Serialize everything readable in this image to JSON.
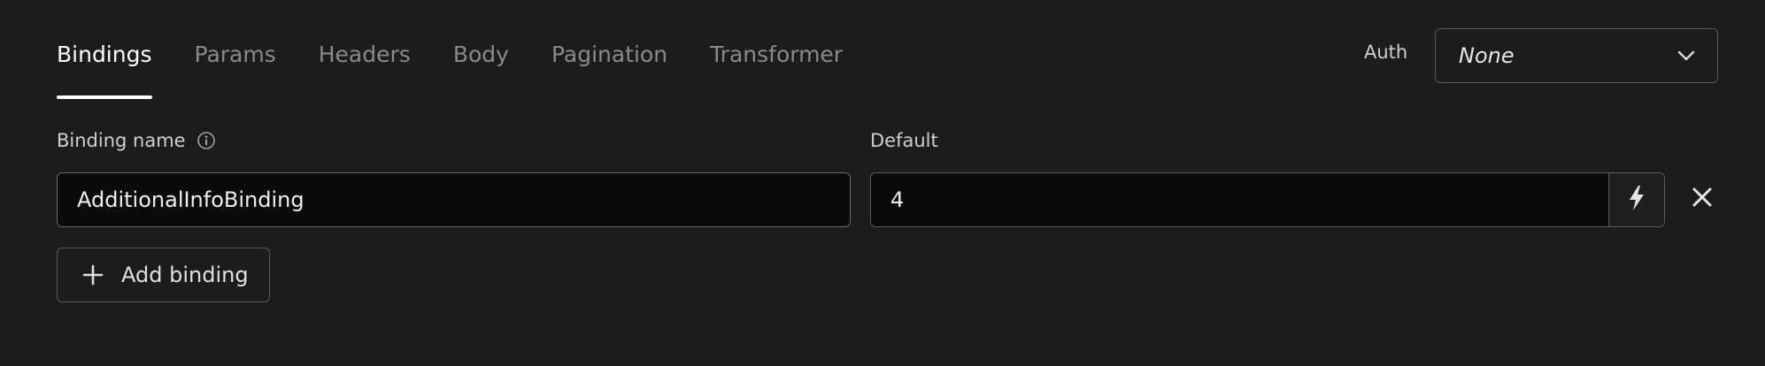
{
  "tabs": [
    {
      "label": "Bindings",
      "active": true
    },
    {
      "label": "Params",
      "active": false
    },
    {
      "label": "Headers",
      "active": false
    },
    {
      "label": "Body",
      "active": false
    },
    {
      "label": "Pagination",
      "active": false
    },
    {
      "label": "Transformer",
      "active": false
    }
  ],
  "auth": {
    "label": "Auth",
    "selected": "None"
  },
  "fields": {
    "binding_name_label": "Binding name",
    "default_label": "Default"
  },
  "binding": {
    "name_value": "AdditionalInfoBinding",
    "default_value": "4"
  },
  "add_binding_label": "Add binding",
  "icons": {
    "info": "info-icon",
    "chevron": "chevron-down-icon",
    "bolt": "bolt-icon",
    "close": "close-icon",
    "plus": "plus-icon"
  }
}
